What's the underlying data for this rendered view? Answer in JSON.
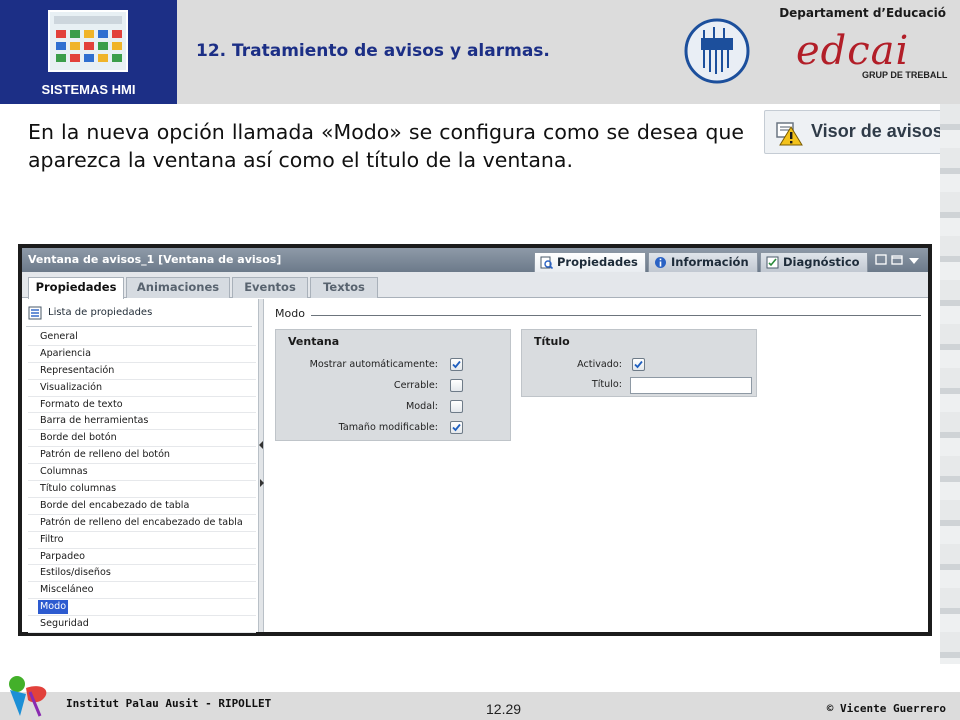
{
  "header": {
    "section_label": "SISTEMAS HMI",
    "slide_title": "12. Tratamiento de avisos y alarmas.",
    "department": "Departament d’Educació",
    "logo_text": "edcai",
    "logo_subtext": "GRUP DE TREBALL"
  },
  "body": {
    "paragraph": "En la nueva opción llamada «Modo» se configura como se desea que aparezca la ventana así como el título de la ventana."
  },
  "visor_badge": {
    "label": "Visor de avisos",
    "icon": "warning-icon"
  },
  "inspector": {
    "window_title": "Ventana de avisos_1 [Ventana de avisos]",
    "top_tabs": [
      {
        "label": "Propiedades",
        "icon": "properties-icon",
        "active": true
      },
      {
        "label": "Información",
        "icon": "info-icon",
        "active": false
      },
      {
        "label": "Diagnóstico",
        "icon": "diagnostic-icon",
        "active": false
      }
    ],
    "sub_tabs": [
      {
        "label": "Propiedades",
        "active": true
      },
      {
        "label": "Animaciones",
        "active": false
      },
      {
        "label": "Eventos",
        "active": false
      },
      {
        "label": "Textos",
        "active": false
      }
    ],
    "property_list_label": "Lista de propiedades",
    "property_items": [
      "General",
      "Apariencia",
      "Representación",
      "Visualización",
      "Formato de texto",
      "Barra de herramientas",
      "Borde del botón",
      "Patrón de relleno del botón",
      "Columnas",
      "Título columnas",
      "Borde del encabezado de tabla",
      "Patrón de relleno del encabezado de tabla",
      "Filtro",
      "Parpadeo",
      "Estilos/diseños",
      "Misceláneo",
      "Modo",
      "Seguridad"
    ],
    "selected_item": "Modo",
    "mode_section_title": "Modo",
    "ventana_group": {
      "title": "Ventana",
      "options": [
        {
          "label": "Mostrar automáticamente:",
          "checked": true
        },
        {
          "label": "Cerrable:",
          "checked": false
        },
        {
          "label": "Modal:",
          "checked": false
        },
        {
          "label": "Tamaño modificable:",
          "checked": true
        }
      ]
    },
    "titulo_group": {
      "title": "Título",
      "activado_label": "Activado:",
      "activado_checked": true,
      "titulo_label": "Título:",
      "titulo_value": ""
    }
  },
  "footer": {
    "institute": "Institut Palau Ausit - RIPOLLET",
    "page_number": "12.29",
    "author": "© Vicente Guerrero"
  },
  "colors": {
    "header_blue": "#1c2f86",
    "selection_blue": "#2d5bd0",
    "logo_red": "#b21e28"
  }
}
